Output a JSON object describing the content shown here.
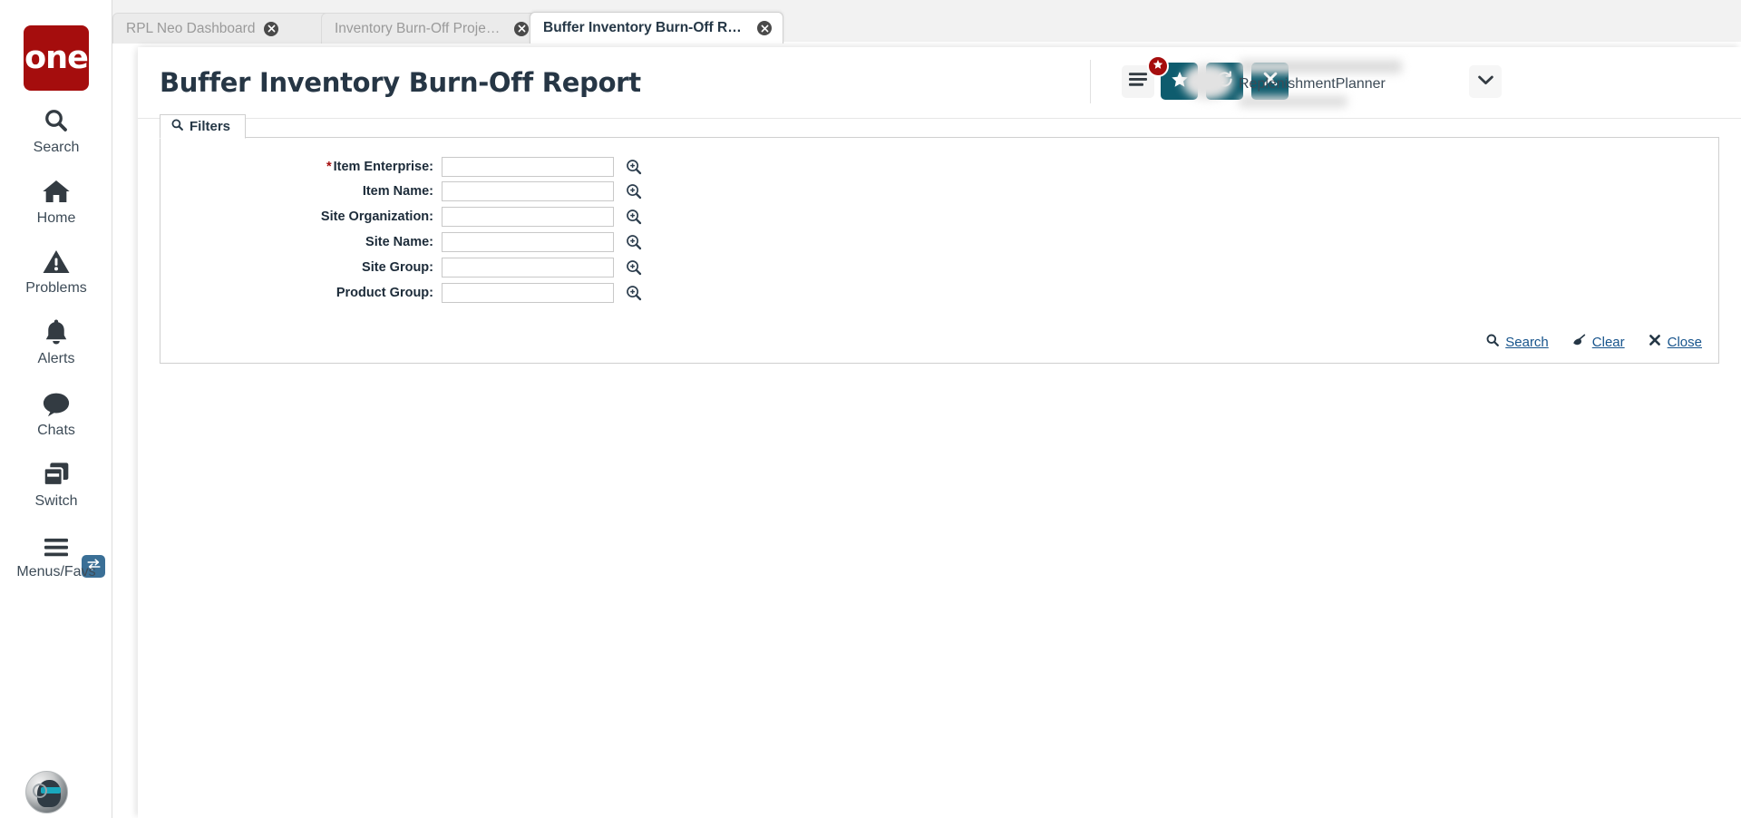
{
  "brand": {
    "logo_text": "one",
    "logo_color": "#a50d0d",
    "accent_color": "#0e5c6e",
    "link_color": "#17548c"
  },
  "sidebar": {
    "items": [
      {
        "label": "Search",
        "icon": "search-icon"
      },
      {
        "label": "Home",
        "icon": "home-icon"
      },
      {
        "label": "Problems",
        "icon": "warning-triangle-icon"
      },
      {
        "label": "Alerts",
        "icon": "bell-icon"
      },
      {
        "label": "Chats",
        "icon": "chat-bubble-icon"
      },
      {
        "label": "Switch",
        "icon": "switch-windows-icon"
      },
      {
        "label": "Menus/Favs",
        "icon": "hamburger-icon"
      }
    ],
    "switch_badge_icon": "transfer-arrows-icon",
    "avatar_icon": "user-avatar-icon"
  },
  "tabs": [
    {
      "label": "RPL Neo Dashboard",
      "active": false,
      "close_icon": "close-circle-icon"
    },
    {
      "label": "Inventory Burn-Off Projected Inv...",
      "active": false,
      "close_icon": "close-circle-icon"
    },
    {
      "label": "Buffer Inventory Burn-Off Report",
      "active": true,
      "close_icon": "close-circle-icon"
    }
  ],
  "header": {
    "title": "Buffer Inventory Burn-Off Report",
    "buttons": [
      {
        "name": "favorite-button",
        "icon": "star-icon"
      },
      {
        "name": "refresh-button",
        "icon": "refresh-icon"
      },
      {
        "name": "close-button",
        "icon": "x-icon"
      }
    ],
    "menu_icon": "hamburger-icon",
    "favorites_badge_icon": "star-icon",
    "user_role": "ReplenishmentPlanner",
    "user_caret_icon": "chevron-down-icon"
  },
  "filters": {
    "tab_label": "Filters",
    "tab_icon": "search-icon",
    "fields": [
      {
        "label": "Item Enterprise:",
        "required": true,
        "value": "",
        "placeholder": "",
        "lookup_icon": "zoom-in-icon"
      },
      {
        "label": "Item Name:",
        "required": false,
        "value": "",
        "placeholder": "",
        "lookup_icon": "zoom-in-icon"
      },
      {
        "label": "Site Organization:",
        "required": false,
        "value": "",
        "placeholder": "",
        "lookup_icon": "zoom-in-icon"
      },
      {
        "label": "Site Name:",
        "required": false,
        "value": "",
        "placeholder": "",
        "lookup_icon": "zoom-in-icon"
      },
      {
        "label": "Site Group:",
        "required": false,
        "value": "",
        "placeholder": "",
        "lookup_icon": "zoom-in-icon"
      },
      {
        "label": "Product Group:",
        "required": false,
        "value": "",
        "placeholder": "",
        "lookup_icon": "zoom-in-icon"
      }
    ],
    "actions": [
      {
        "label": "Search",
        "icon": "search-icon"
      },
      {
        "label": "Clear",
        "icon": "broom-icon"
      },
      {
        "label": "Close",
        "icon": "x-icon"
      }
    ]
  }
}
